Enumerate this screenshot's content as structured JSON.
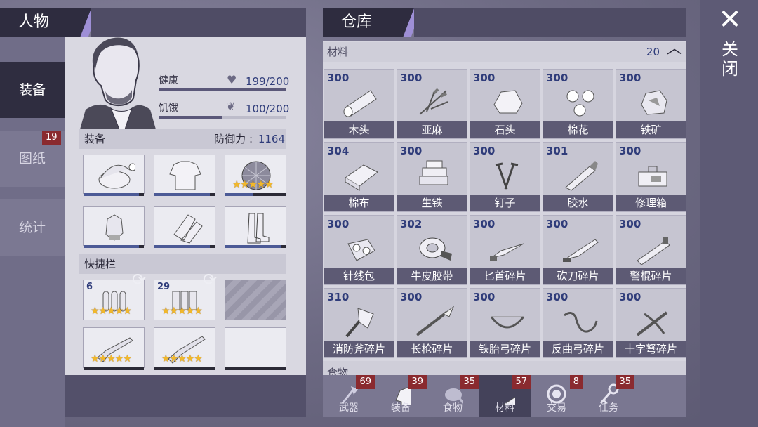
{
  "character": {
    "title": "人物",
    "tabs": [
      {
        "label": "装备",
        "active": true,
        "badge": ""
      },
      {
        "label": "图纸",
        "active": false,
        "badge": "19"
      },
      {
        "label": "统计",
        "active": false,
        "badge": ""
      }
    ],
    "health": {
      "label": "健康",
      "value": "199/200",
      "fraction": 0.995
    },
    "hunger": {
      "label": "饥饿",
      "value": "100/200",
      "fraction": 0.5
    },
    "equipment": {
      "label": "装备",
      "defense_label": "防御力 :",
      "defense_value": "1164",
      "slots": [
        {
          "icon": "knit-hat-icon",
          "stars": "",
          "durability": 0.92
        },
        {
          "icon": "shirt-icon",
          "stars": "",
          "durability": 0.92
        },
        {
          "icon": "turtle-shell-armor-icon",
          "stars": "★★★★★",
          "durability": 0.45
        },
        {
          "icon": "gloves-icon",
          "stars": "",
          "durability": 0.92
        },
        {
          "icon": "pants-icon",
          "stars": "",
          "durability": 0.92
        },
        {
          "icon": "boots-icon",
          "stars": "",
          "durability": 0.92
        }
      ]
    },
    "hotbar": {
      "label": "快捷栏",
      "slots": [
        {
          "icon": "bullets-icon",
          "count": "6",
          "stars": "★★★★★",
          "refresh": true
        },
        {
          "icon": "shotgun-shells-icon",
          "count": "29",
          "stars": "★★★★★",
          "refresh": true
        },
        {
          "icon": "locked-slot-icon",
          "count": "",
          "stars": "",
          "refresh": false
        },
        {
          "icon": "rifle-icon",
          "count": "",
          "stars": "★★★★★",
          "refresh": false
        },
        {
          "icon": "shotgun-icon",
          "count": "",
          "stars": "★★★★★",
          "refresh": false
        },
        {
          "icon": "empty-slot",
          "count": "",
          "stars": "",
          "refresh": false
        }
      ]
    }
  },
  "warehouse": {
    "title": "仓库",
    "category": {
      "label": "材料",
      "count": "20"
    },
    "next_category_partial": "食物",
    "items": [
      {
        "count": "300",
        "name": "木头",
        "icon": "log-icon"
      },
      {
        "count": "300",
        "name": "亚麻",
        "icon": "flax-icon"
      },
      {
        "count": "300",
        "name": "石头",
        "icon": "stone-icon"
      },
      {
        "count": "300",
        "name": "棉花",
        "icon": "cotton-icon"
      },
      {
        "count": "300",
        "name": "铁矿",
        "icon": "iron-ore-icon"
      },
      {
        "count": "304",
        "name": "棉布",
        "icon": "cloth-icon"
      },
      {
        "count": "300",
        "name": "生铁",
        "icon": "pig-iron-icon"
      },
      {
        "count": "300",
        "name": "钉子",
        "icon": "nails-icon"
      },
      {
        "count": "301",
        "name": "胶水",
        "icon": "glue-icon"
      },
      {
        "count": "300",
        "name": "修理箱",
        "icon": "repair-kit-icon"
      },
      {
        "count": "300",
        "name": "针线包",
        "icon": "sewing-kit-icon"
      },
      {
        "count": "302",
        "name": "牛皮胶带",
        "icon": "duct-tape-icon"
      },
      {
        "count": "300",
        "name": "匕首碎片",
        "icon": "dagger-fragment-icon"
      },
      {
        "count": "300",
        "name": "砍刀碎片",
        "icon": "machete-fragment-icon"
      },
      {
        "count": "300",
        "name": "警棍碎片",
        "icon": "baton-fragment-icon"
      },
      {
        "count": "310",
        "name": "消防斧碎片",
        "icon": "fire-axe-fragment-icon"
      },
      {
        "count": "300",
        "name": "长枪碎片",
        "icon": "spear-fragment-icon"
      },
      {
        "count": "300",
        "name": "铁胎弓碎片",
        "icon": "iron-bow-fragment-icon"
      },
      {
        "count": "300",
        "name": "反曲弓碎片",
        "icon": "recurve-bow-fragment-icon"
      },
      {
        "count": "300",
        "name": "十字弩碎片",
        "icon": "crossbow-fragment-icon"
      }
    ],
    "bottom_tabs": [
      {
        "label": "武器",
        "badge": "69",
        "icon": "axe-icon",
        "active": false
      },
      {
        "label": "装备",
        "badge": "39",
        "icon": "shirt-icon",
        "active": false
      },
      {
        "label": "食物",
        "badge": "35",
        "icon": "meat-icon",
        "active": false
      },
      {
        "label": "材料",
        "badge": "57",
        "icon": "log-icon",
        "active": true
      },
      {
        "label": "交易",
        "badge": "8",
        "icon": "coin-icon",
        "active": false
      },
      {
        "label": "任务",
        "badge": "35",
        "icon": "key-icon",
        "active": false
      }
    ]
  },
  "close": {
    "label": "关闭",
    "icon": "close-icon"
  },
  "colors": {
    "header": "#2e2c3f",
    "accent": "#9e8fd6",
    "count_blue": "#2f3c7a",
    "badge_red": "#8a2a2f",
    "star_gold": "#f2b82a"
  }
}
